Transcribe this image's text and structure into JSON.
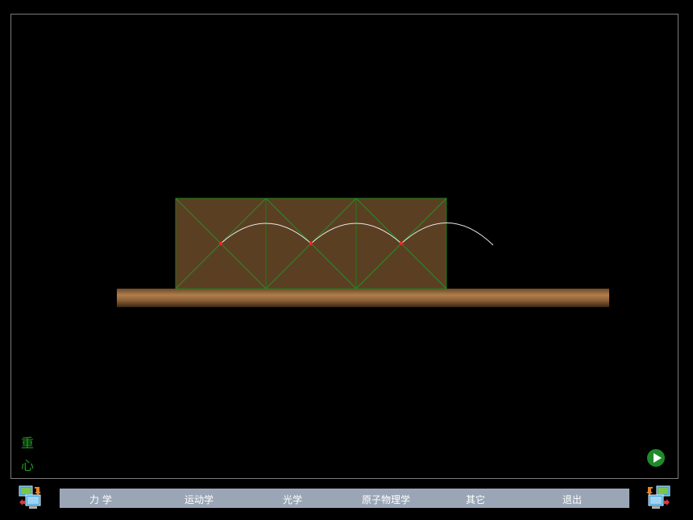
{
  "label": {
    "line1": "重",
    "line2": "心"
  },
  "nav": {
    "items": [
      "力 学",
      "运动学",
      "光学",
      "原子物理学",
      "其它",
      "退出"
    ]
  },
  "icons": {
    "left": "computer-exchange-icon",
    "right": "computer-exchange-icon",
    "play": "play-icon"
  },
  "colors": {
    "box_fill": "#5b3f22",
    "box_stroke": "#1e7a1e",
    "diagonal": "#2a8a2a",
    "arc": "#e8e8e8",
    "center_dot": "#ff2020",
    "label": "#1f9a1f",
    "nav_bg": "#9aa6b6"
  }
}
